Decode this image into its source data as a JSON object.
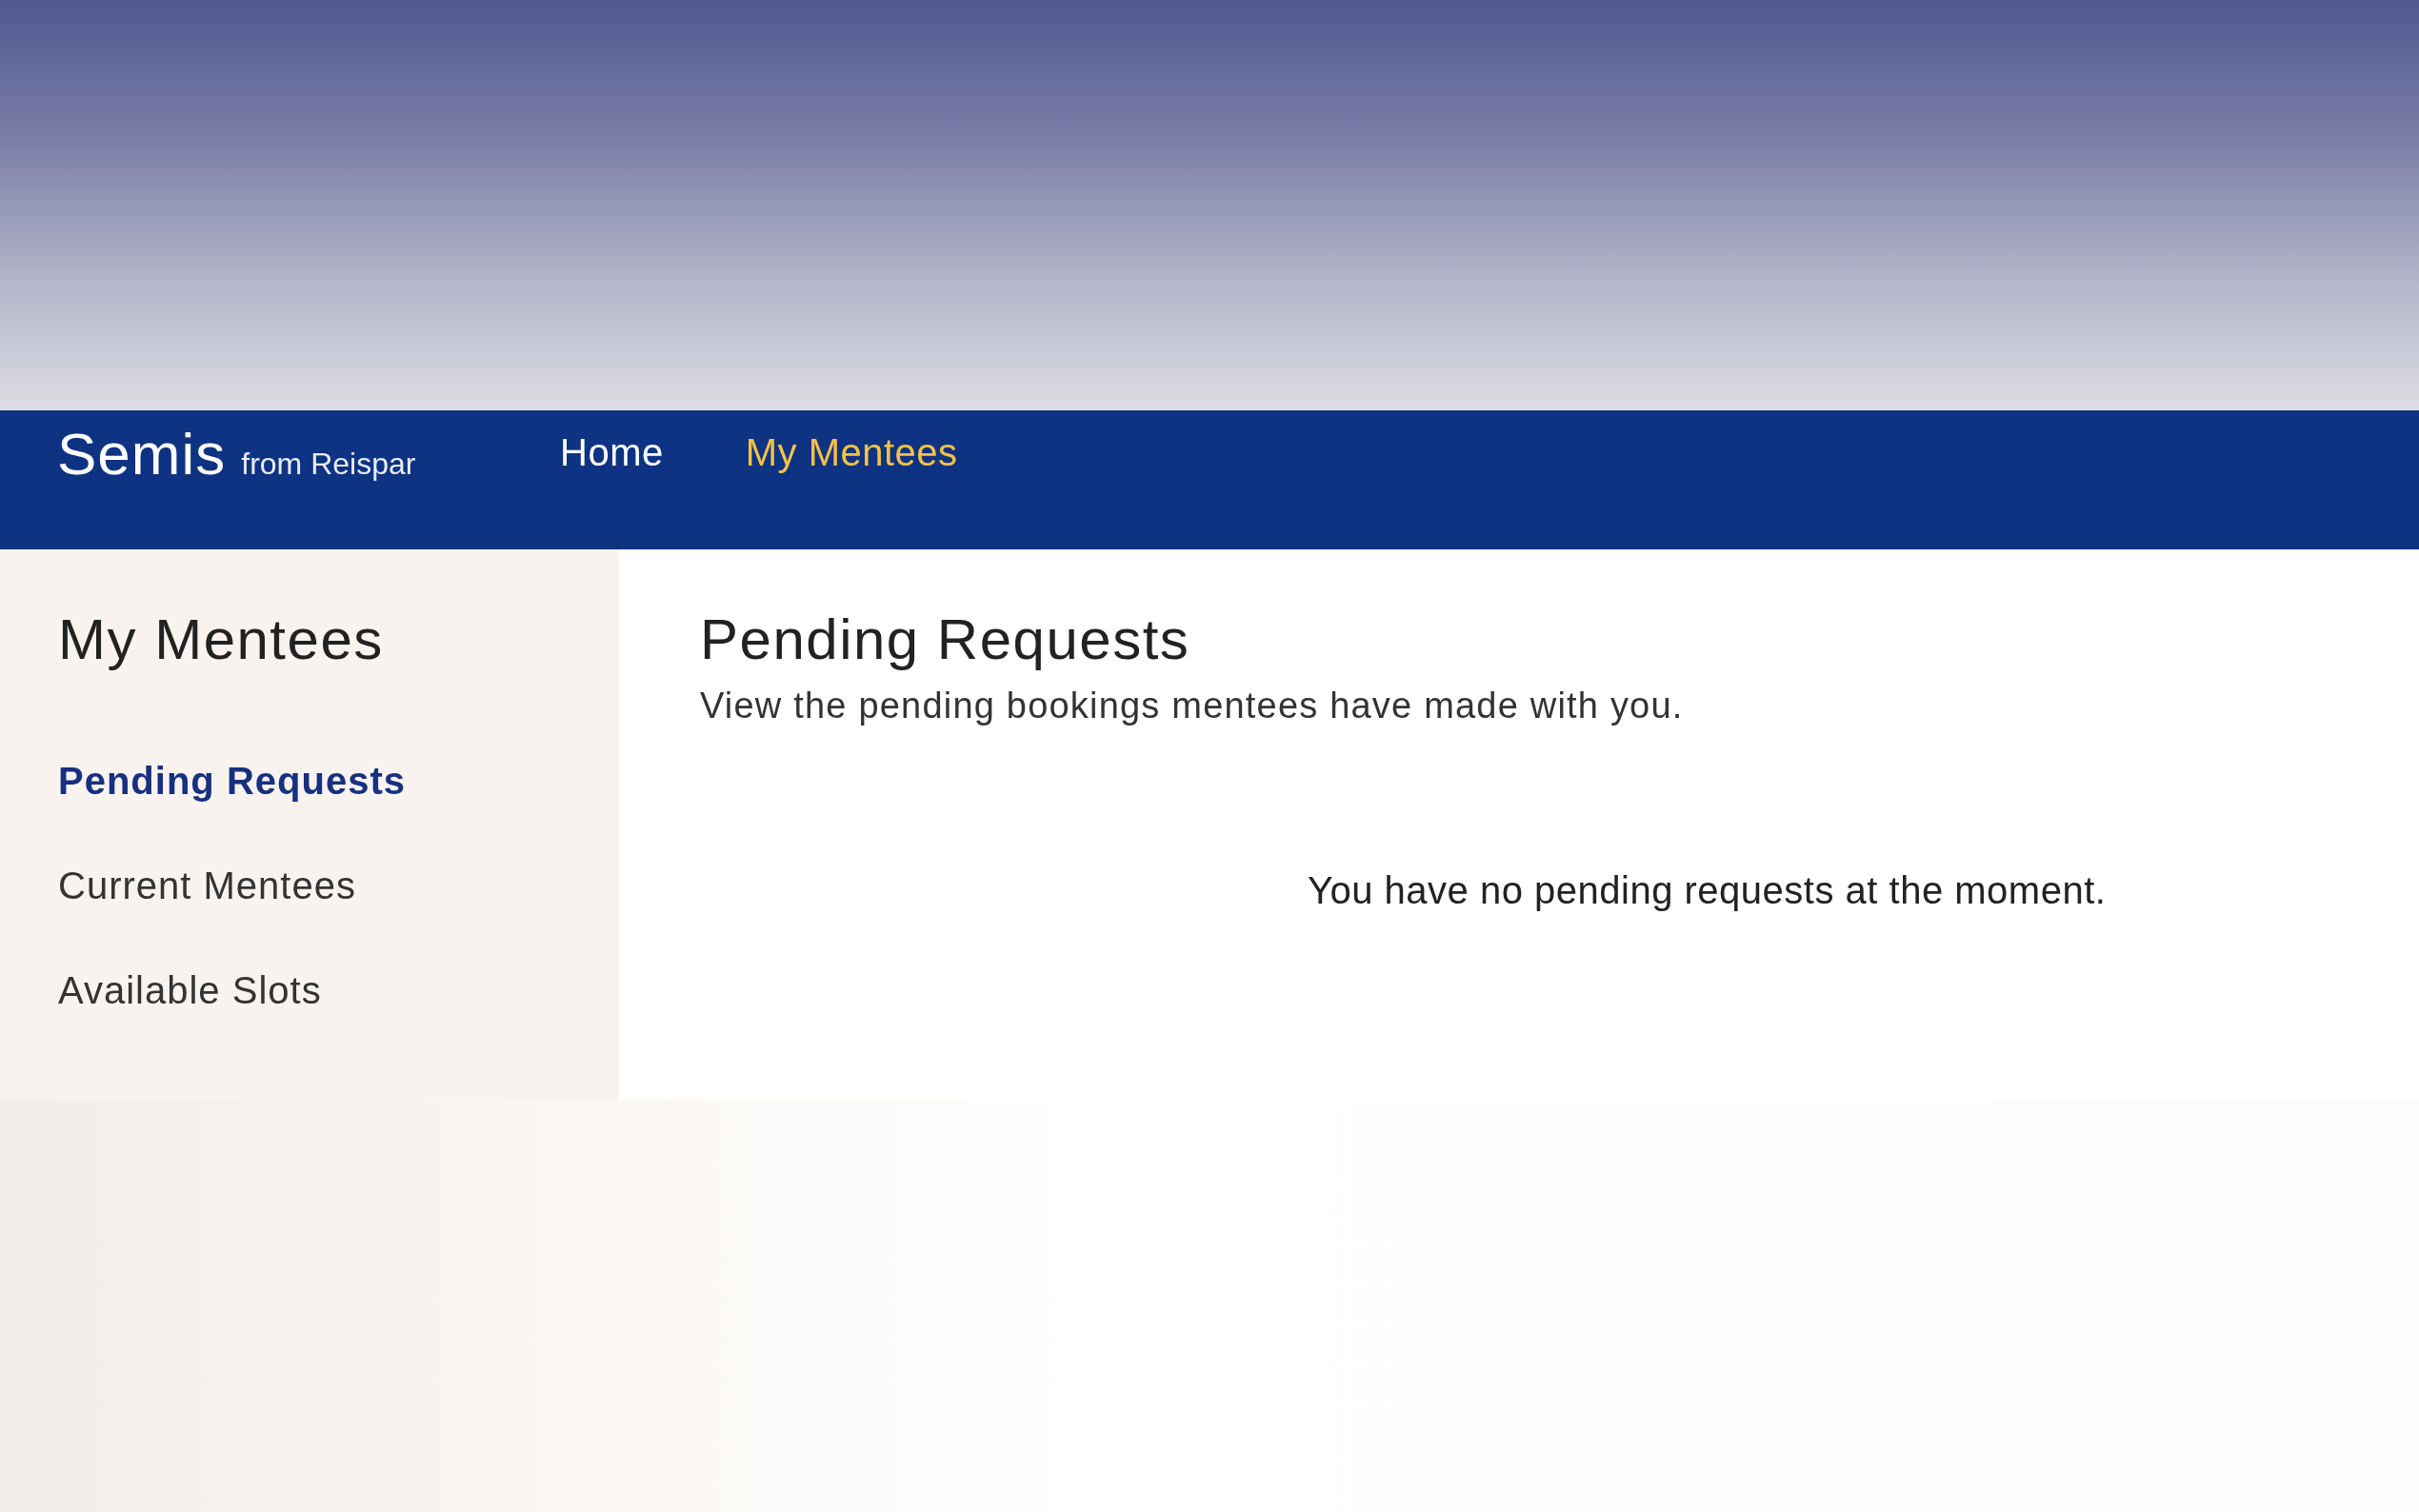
{
  "brand": {
    "name": "Semis",
    "byline": "from Reispar"
  },
  "nav": [
    {
      "label": "Home",
      "selected": false
    },
    {
      "label": "My Mentees",
      "selected": true
    }
  ],
  "sidebar": {
    "title": "My Mentees",
    "items": [
      {
        "label": "Pending Requests",
        "selected": true
      },
      {
        "label": "Current Mentees",
        "selected": false
      },
      {
        "label": "Available Slots",
        "selected": false
      }
    ]
  },
  "main": {
    "title": "Pending Requests",
    "subtitle": "View the pending bookings mentees have made with you.",
    "empty_message": "You have no pending requests at the moment."
  }
}
